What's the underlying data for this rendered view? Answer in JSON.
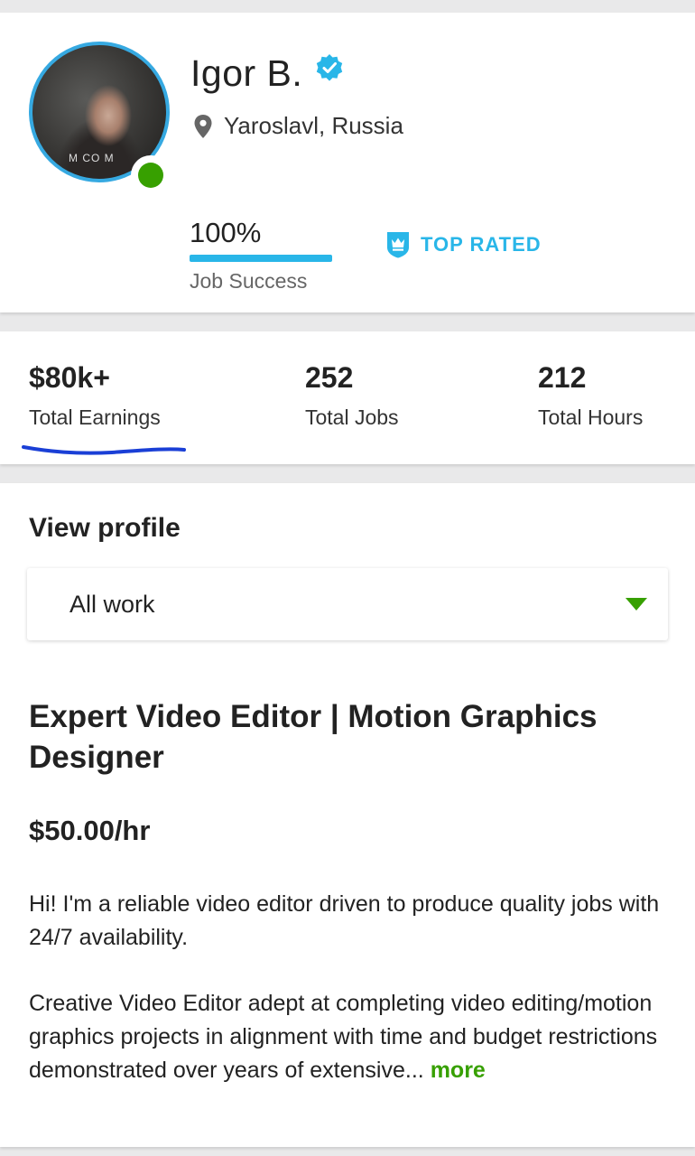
{
  "profile": {
    "name": "Igor B.",
    "location": "Yaroslavl, Russia",
    "avatar_shirt_text": "M CO M",
    "online": true,
    "job_success": {
      "value": "100%",
      "fraction": 1.0,
      "label": "Job Success"
    },
    "badge": "TOP RATED"
  },
  "stats": [
    {
      "value": "$80k+",
      "label": "Total Earnings"
    },
    {
      "value": "252",
      "label": "Total Jobs"
    },
    {
      "value": "212",
      "label": "Total Hours"
    }
  ],
  "view_profile": {
    "title": "View profile",
    "selected": "All work"
  },
  "listing": {
    "headline": "Expert Video Editor | Motion Graphics Designer",
    "rate": "$50.00/hr",
    "intro": "Hi! I'm a reliable video editor driven to produce quality jobs with 24/7 availability.",
    "description": "Creative Video Editor adept at completing video editing/motion graphics projects in alignment with time and budget restrictions demonstrated over years of extensive...",
    "more_label": "more"
  },
  "colors": {
    "accent_blue": "#29b6e8",
    "online_green": "#37a000",
    "annotation_blue": "#1a3fd6"
  },
  "icons": {
    "verified": "verified-badge-icon",
    "location": "map-pin-icon",
    "top_rated": "crown-shield-icon",
    "dropdown": "caret-down-icon"
  }
}
